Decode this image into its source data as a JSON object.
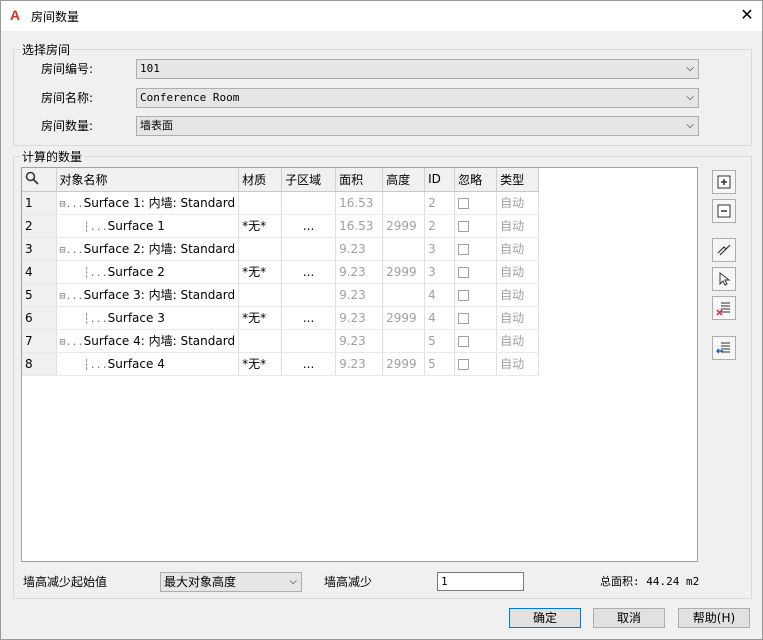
{
  "window": {
    "title": "房间数量"
  },
  "select_room": {
    "group_label": "选择房间",
    "fields": [
      {
        "label": "房间编号:",
        "value": "101"
      },
      {
        "label": "房间名称:",
        "value": "Conference Room"
      },
      {
        "label": "房间数量:",
        "value": "墙表面"
      }
    ]
  },
  "calc": {
    "group_label": "计算的数量",
    "columns": [
      "对象名称",
      "材质",
      "子区域",
      "面积",
      "高度",
      "ID",
      "忽略",
      "类型"
    ],
    "rows": [
      {
        "num": "1",
        "name": "Surface 1: 内墙: Standard",
        "material": "",
        "sub": "",
        "area": "16.53",
        "height": "",
        "id": "2",
        "type": "自动",
        "child": false
      },
      {
        "num": "2",
        "name": "Surface 1",
        "material": "*无*",
        "sub": "...",
        "area": "16.53",
        "height": "2999",
        "id": "2",
        "type": "自动",
        "child": true
      },
      {
        "num": "3",
        "name": "Surface 2: 内墙: Standard",
        "material": "",
        "sub": "",
        "area": "9.23",
        "height": "",
        "id": "3",
        "type": "自动",
        "child": false
      },
      {
        "num": "4",
        "name": "Surface 2",
        "material": "*无*",
        "sub": "...",
        "area": "9.23",
        "height": "2999",
        "id": "3",
        "type": "自动",
        "child": true
      },
      {
        "num": "5",
        "name": "Surface 3: 内墙: Standard",
        "material": "",
        "sub": "",
        "area": "9.23",
        "height": "",
        "id": "4",
        "type": "自动",
        "child": false
      },
      {
        "num": "6",
        "name": "Surface 3",
        "material": "*无*",
        "sub": "...",
        "area": "9.23",
        "height": "2999",
        "id": "4",
        "type": "自动",
        "child": true
      },
      {
        "num": "7",
        "name": "Surface 4: 内墙: Standard",
        "material": "",
        "sub": "",
        "area": "9.23",
        "height": "",
        "id": "5",
        "type": "自动",
        "child": false
      },
      {
        "num": "8",
        "name": "Surface 4",
        "material": "*无*",
        "sub": "...",
        "area": "9.23",
        "height": "2999",
        "id": "5",
        "type": "自动",
        "child": true
      }
    ],
    "wall_start_label": "墙高减少起始值",
    "wall_start_value": "最大对象高度",
    "wall_reduce_label": "墙高减少",
    "wall_reduce_value": "1",
    "total_area": "总面积: 44.24 m2"
  },
  "buttons": {
    "ok": "确定",
    "cancel": "取消",
    "help": "帮助(H)"
  }
}
